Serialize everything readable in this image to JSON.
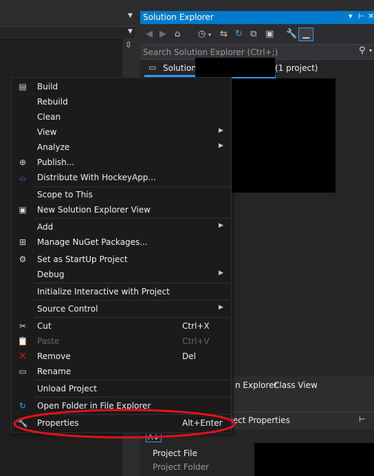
{
  "solution_explorer": {
    "title": "Solution Explorer",
    "search_placeholder": "Search Solution Explorer (Ctrl+;)",
    "solution_label": "Solution",
    "solution_suffix": "(1 project)",
    "toolbar_icons": [
      "back-icon",
      "forward-icon",
      "home-icon",
      "history-icon",
      "sync-icon",
      "refresh-icon",
      "collapse-all-icon",
      "show-all-files-icon",
      "properties-wrench-icon",
      "preview-icon"
    ]
  },
  "bottom_tabs": {
    "solution_explorer_partial": "n Explorer",
    "class_view": "Class View"
  },
  "properties": {
    "header_partial": "oject Properties",
    "rows": [
      "Project File",
      "Project Folder"
    ]
  },
  "context_menu": {
    "items": [
      {
        "label": "Build",
        "icon": "build-icon"
      },
      {
        "label": "Rebuild"
      },
      {
        "label": "Clean"
      },
      {
        "label": "View",
        "submenu": true
      },
      {
        "label": "Analyze",
        "submenu": true
      },
      {
        "label": "Publish...",
        "icon": "globe-icon"
      },
      {
        "label": "Distribute With HockeyApp...",
        "icon": "hockeyapp-icon"
      },
      {
        "label": "Scope to This"
      },
      {
        "label": "New Solution Explorer View",
        "icon": "new-view-icon"
      },
      {
        "label": "Add",
        "submenu": true
      },
      {
        "label": "Manage NuGet Packages...",
        "icon": "nuget-icon"
      },
      {
        "label": "Set as StartUp Project",
        "icon": "gear-icon"
      },
      {
        "label": "Debug",
        "submenu": true
      },
      {
        "label": "Initialize Interactive with Project"
      },
      {
        "label": "Source Control",
        "submenu": true
      },
      {
        "label": "Cut",
        "shortcut": "Ctrl+X",
        "icon": "scissors-icon"
      },
      {
        "label": "Paste",
        "shortcut": "Ctrl+V",
        "icon": "paste-icon",
        "disabled": true
      },
      {
        "label": "Remove",
        "shortcut": "Del",
        "icon": "remove-x-icon"
      },
      {
        "label": "Rename",
        "icon": "rename-icon"
      },
      {
        "label": "Unload Project"
      },
      {
        "label": "Open Folder in File Explorer",
        "icon": "open-folder-icon"
      },
      {
        "label": "Properties",
        "shortcut": "Alt+Enter",
        "icon": "wrench-icon"
      }
    ]
  },
  "colors": {
    "accent": "#007acc",
    "menu_background": "#1b1b1c",
    "highlight_ellipse": "#e8101c"
  }
}
